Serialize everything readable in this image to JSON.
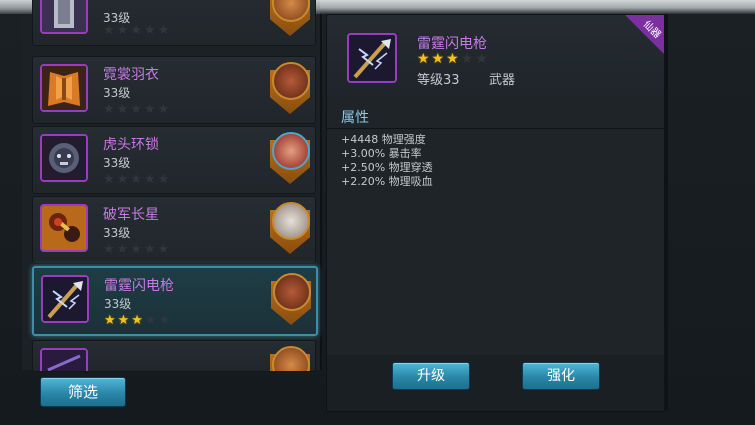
{
  "equipment_list": [
    {
      "name": "",
      "level": "33级",
      "stars": 0,
      "partial": "top",
      "icon": "silver-armor-icon",
      "hero": "hero-portrait-orange-icon"
    },
    {
      "name": "霓裳羽衣",
      "level": "33级",
      "stars": 0,
      "icon": "feather-robe-icon",
      "hero": "hero-portrait-warrior-icon"
    },
    {
      "name": "虎头环锁",
      "level": "33级",
      "stars": 0,
      "icon": "tiger-helmet-icon",
      "hero": "hero-portrait-redhair-icon"
    },
    {
      "name": "破军长星",
      "level": "33级",
      "stars": 0,
      "icon": "flail-weapon-icon",
      "hero": "hero-portrait-whitehair-icon"
    },
    {
      "name": "雷霆闪电枪",
      "level": "33级",
      "stars": 3,
      "selected": true,
      "icon": "lightning-spear-icon",
      "hero": "hero-portrait-warrior-icon"
    },
    {
      "name": "",
      "level": "",
      "stars": 0,
      "partial": "bottom",
      "icon": "purple-item-icon",
      "hero": "hero-portrait-orange-icon"
    }
  ],
  "filter_button_label": "筛选",
  "detail": {
    "name": "雷霆闪电枪",
    "stars": 3,
    "level": "等级33",
    "type": "武器",
    "corner_badge": "仙器",
    "icon": "lightning-spear-icon",
    "attr_title": "属性",
    "attributes": [
      "+4448 物理强度",
      "+3.00% 暴击率",
      "+2.50% 物理穿透",
      "+2.20% 物理吸血"
    ]
  },
  "upgrade_button_label": "升级",
  "enhance_button_label": "强化",
  "colors": {
    "item_name": "#c77ae6",
    "star": "#f4c21c",
    "button": "#2a86a8",
    "selected_border": "#3c8fa6"
  }
}
